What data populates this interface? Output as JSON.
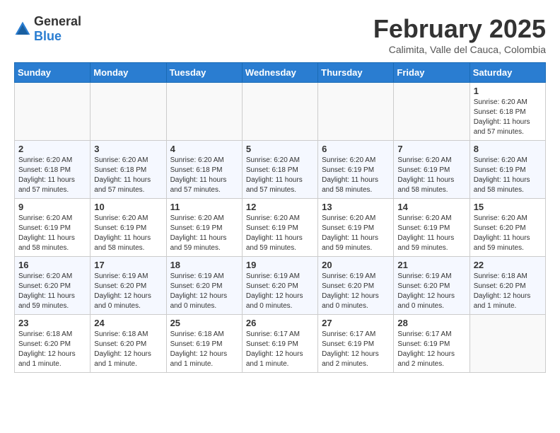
{
  "header": {
    "logo_general": "General",
    "logo_blue": "Blue",
    "month_title": "February 2025",
    "subtitle": "Calimita, Valle del Cauca, Colombia"
  },
  "weekdays": [
    "Sunday",
    "Monday",
    "Tuesday",
    "Wednesday",
    "Thursday",
    "Friday",
    "Saturday"
  ],
  "weeks": [
    [
      {
        "day": "",
        "info": ""
      },
      {
        "day": "",
        "info": ""
      },
      {
        "day": "",
        "info": ""
      },
      {
        "day": "",
        "info": ""
      },
      {
        "day": "",
        "info": ""
      },
      {
        "day": "",
        "info": ""
      },
      {
        "day": "1",
        "info": "Sunrise: 6:20 AM\nSunset: 6:18 PM\nDaylight: 11 hours\nand 57 minutes."
      }
    ],
    [
      {
        "day": "2",
        "info": "Sunrise: 6:20 AM\nSunset: 6:18 PM\nDaylight: 11 hours\nand 57 minutes."
      },
      {
        "day": "3",
        "info": "Sunrise: 6:20 AM\nSunset: 6:18 PM\nDaylight: 11 hours\nand 57 minutes."
      },
      {
        "day": "4",
        "info": "Sunrise: 6:20 AM\nSunset: 6:18 PM\nDaylight: 11 hours\nand 57 minutes."
      },
      {
        "day": "5",
        "info": "Sunrise: 6:20 AM\nSunset: 6:18 PM\nDaylight: 11 hours\nand 57 minutes."
      },
      {
        "day": "6",
        "info": "Sunrise: 6:20 AM\nSunset: 6:19 PM\nDaylight: 11 hours\nand 58 minutes."
      },
      {
        "day": "7",
        "info": "Sunrise: 6:20 AM\nSunset: 6:19 PM\nDaylight: 11 hours\nand 58 minutes."
      },
      {
        "day": "8",
        "info": "Sunrise: 6:20 AM\nSunset: 6:19 PM\nDaylight: 11 hours\nand 58 minutes."
      }
    ],
    [
      {
        "day": "9",
        "info": "Sunrise: 6:20 AM\nSunset: 6:19 PM\nDaylight: 11 hours\nand 58 minutes."
      },
      {
        "day": "10",
        "info": "Sunrise: 6:20 AM\nSunset: 6:19 PM\nDaylight: 11 hours\nand 58 minutes."
      },
      {
        "day": "11",
        "info": "Sunrise: 6:20 AM\nSunset: 6:19 PM\nDaylight: 11 hours\nand 59 minutes."
      },
      {
        "day": "12",
        "info": "Sunrise: 6:20 AM\nSunset: 6:19 PM\nDaylight: 11 hours\nand 59 minutes."
      },
      {
        "day": "13",
        "info": "Sunrise: 6:20 AM\nSunset: 6:19 PM\nDaylight: 11 hours\nand 59 minutes."
      },
      {
        "day": "14",
        "info": "Sunrise: 6:20 AM\nSunset: 6:19 PM\nDaylight: 11 hours\nand 59 minutes."
      },
      {
        "day": "15",
        "info": "Sunrise: 6:20 AM\nSunset: 6:20 PM\nDaylight: 11 hours\nand 59 minutes."
      }
    ],
    [
      {
        "day": "16",
        "info": "Sunrise: 6:20 AM\nSunset: 6:20 PM\nDaylight: 11 hours\nand 59 minutes."
      },
      {
        "day": "17",
        "info": "Sunrise: 6:19 AM\nSunset: 6:20 PM\nDaylight: 12 hours\nand 0 minutes."
      },
      {
        "day": "18",
        "info": "Sunrise: 6:19 AM\nSunset: 6:20 PM\nDaylight: 12 hours\nand 0 minutes."
      },
      {
        "day": "19",
        "info": "Sunrise: 6:19 AM\nSunset: 6:20 PM\nDaylight: 12 hours\nand 0 minutes."
      },
      {
        "day": "20",
        "info": "Sunrise: 6:19 AM\nSunset: 6:20 PM\nDaylight: 12 hours\nand 0 minutes."
      },
      {
        "day": "21",
        "info": "Sunrise: 6:19 AM\nSunset: 6:20 PM\nDaylight: 12 hours\nand 0 minutes."
      },
      {
        "day": "22",
        "info": "Sunrise: 6:18 AM\nSunset: 6:20 PM\nDaylight: 12 hours\nand 1 minute."
      }
    ],
    [
      {
        "day": "23",
        "info": "Sunrise: 6:18 AM\nSunset: 6:20 PM\nDaylight: 12 hours\nand 1 minute."
      },
      {
        "day": "24",
        "info": "Sunrise: 6:18 AM\nSunset: 6:20 PM\nDaylight: 12 hours\nand 1 minute."
      },
      {
        "day": "25",
        "info": "Sunrise: 6:18 AM\nSunset: 6:19 PM\nDaylight: 12 hours\nand 1 minute."
      },
      {
        "day": "26",
        "info": "Sunrise: 6:17 AM\nSunset: 6:19 PM\nDaylight: 12 hours\nand 1 minute."
      },
      {
        "day": "27",
        "info": "Sunrise: 6:17 AM\nSunset: 6:19 PM\nDaylight: 12 hours\nand 2 minutes."
      },
      {
        "day": "28",
        "info": "Sunrise: 6:17 AM\nSunset: 6:19 PM\nDaylight: 12 hours\nand 2 minutes."
      },
      {
        "day": "",
        "info": ""
      }
    ]
  ]
}
